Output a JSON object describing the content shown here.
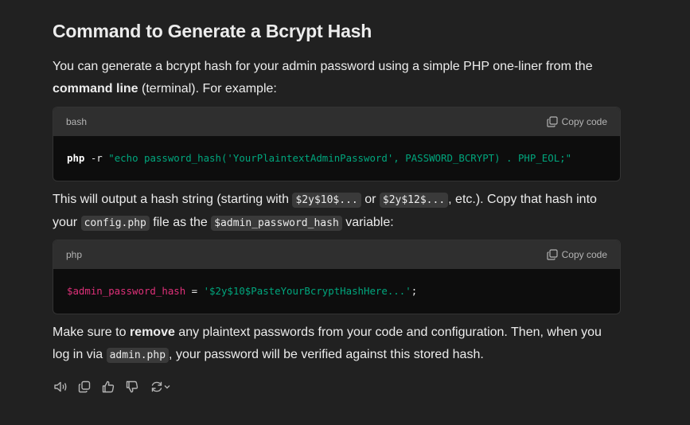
{
  "heading": "Command to Generate a Bcrypt Hash",
  "para1": {
    "line1": "You can generate a bcrypt hash for your admin password using a simple PHP one-liner from the",
    "bold": "command line",
    "rest": " (terminal). For example:"
  },
  "code1": {
    "lang": "bash",
    "copy_label": "Copy code",
    "cmd": "php",
    "flag": " -r ",
    "string": "\"echo password_hash('YourPlaintextAdminPassword', PASSWORD_BCRYPT) . PHP_EOL;\""
  },
  "para2": {
    "t1": "This will output a hash string (starting with ",
    "c1": "$2y$10$...",
    "t2": " or ",
    "c2": "$2y$12$...",
    "t3": ", etc.). Copy that hash into",
    "t4": "your ",
    "c3": "config.php",
    "t5": " file as the ",
    "c4": "$admin_password_hash",
    "t6": " variable:"
  },
  "code2": {
    "lang": "php",
    "copy_label": "Copy code",
    "var": "$admin_password_hash",
    "op": " = ",
    "string": "'$2y$10$PasteYourBcryptHashHere...'",
    "end": ";"
  },
  "para3": {
    "t1": "Make sure to ",
    "bold": "remove",
    "t2": " any plaintext passwords from your code and configuration. Then, when you",
    "t3": "log in via ",
    "c1": "admin.php",
    "t4": ", your password will be verified against this stored hash."
  },
  "actions": {
    "icons": [
      "read-aloud-icon",
      "copy-icon",
      "thumbs-up-icon",
      "thumbs-down-icon",
      "regenerate-icon"
    ]
  }
}
